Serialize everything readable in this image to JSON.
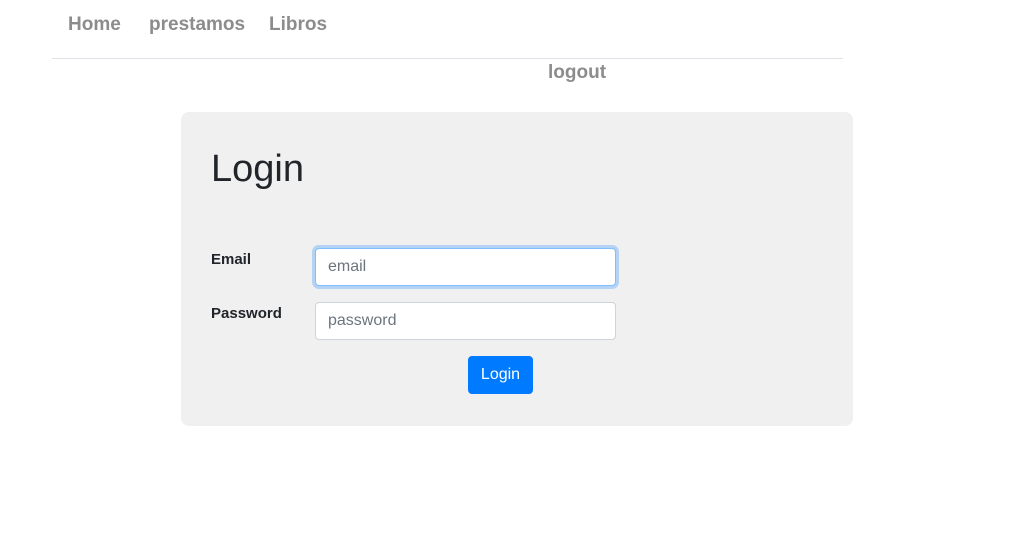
{
  "nav": {
    "items": [
      {
        "label": "Home"
      },
      {
        "label": "prestamos"
      },
      {
        "label": "Libros"
      }
    ],
    "logout_label": "logout"
  },
  "login_card": {
    "title": "Login",
    "email": {
      "label": "Email",
      "value": "",
      "placeholder": "email"
    },
    "password": {
      "label": "Password",
      "value": "",
      "placeholder": "password"
    },
    "submit_label": "Login"
  },
  "colors": {
    "nav_text": "#8c8c8c",
    "card_background": "#f0f0f0",
    "button_primary": "#007bff",
    "focus_ring": "#80bdff"
  }
}
